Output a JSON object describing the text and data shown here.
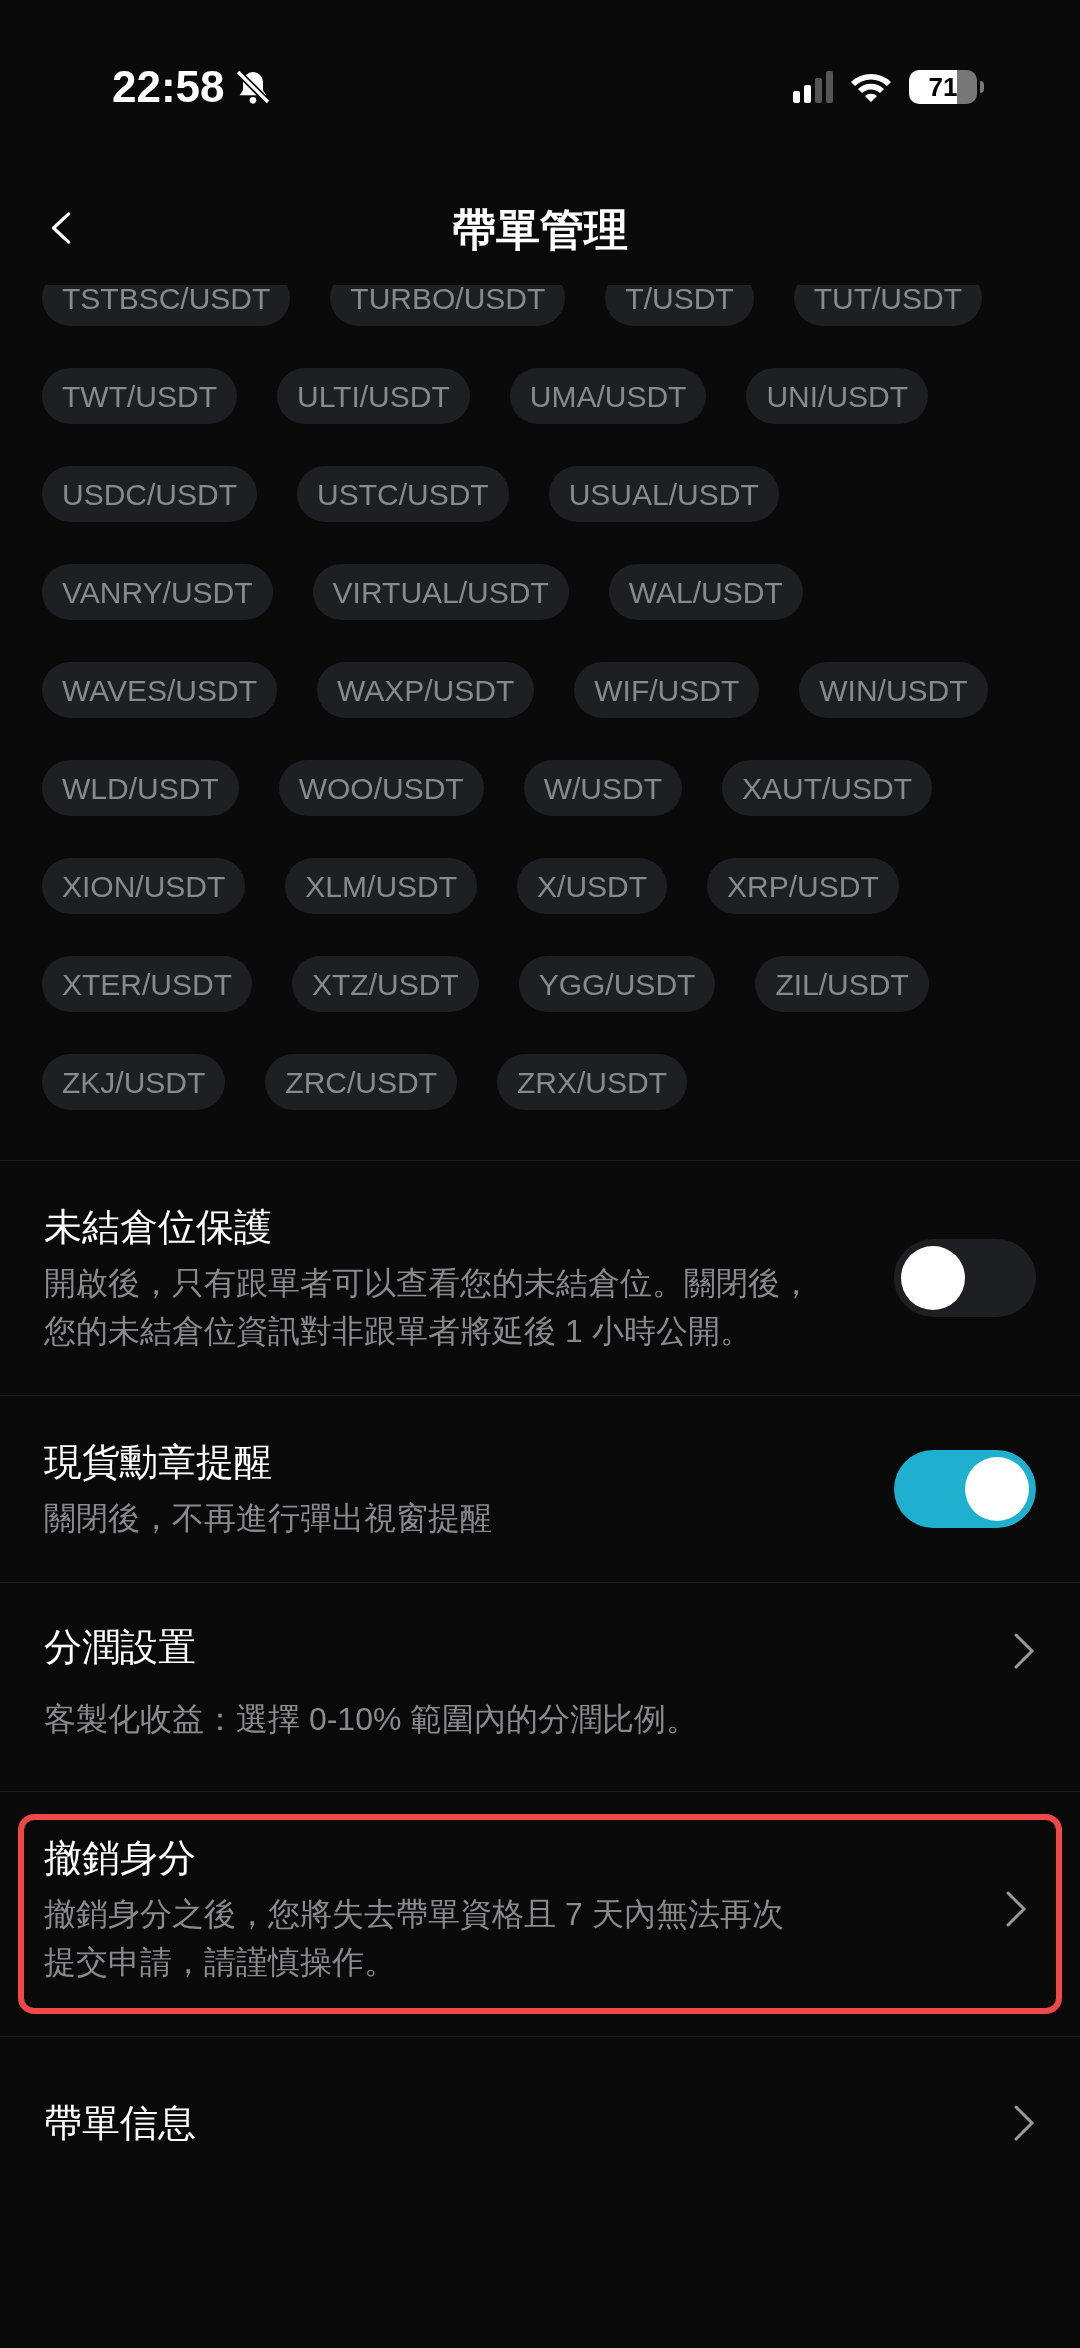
{
  "status_bar": {
    "time": "22:58",
    "silent": true,
    "battery": "71"
  },
  "header": {
    "title": "帶單管理"
  },
  "pair_rows": [
    [
      "TSTBSC/USDT",
      "TURBO/USDT",
      "T/USDT",
      "TUT/USDT"
    ],
    [
      "TWT/USDT",
      "ULTI/USDT",
      "UMA/USDT",
      "UNI/USDT"
    ],
    [
      "USDC/USDT",
      "USTC/USDT",
      "USUAL/USDT"
    ],
    [
      "VANRY/USDT",
      "VIRTUAL/USDT",
      "WAL/USDT"
    ],
    [
      "WAVES/USDT",
      "WAXP/USDT",
      "WIF/USDT",
      "WIN/USDT"
    ],
    [
      "WLD/USDT",
      "WOO/USDT",
      "W/USDT",
      "XAUT/USDT"
    ],
    [
      "XION/USDT",
      "XLM/USDT",
      "X/USDT",
      "XRP/USDT"
    ],
    [
      "XTER/USDT",
      "XTZ/USDT",
      "YGG/USDT",
      "ZIL/USDT"
    ],
    [
      "ZKJ/USDT",
      "ZRC/USDT",
      "ZRX/USDT"
    ]
  ],
  "settings": [
    {
      "kind": "toggle",
      "title": "未結倉位保護",
      "description": "開啟後，只有跟單者可以查看您的未結倉位。關閉後，您的未結倉位資訊對非跟單者將延後 1 小時公開。",
      "on": false,
      "highlighted": false
    },
    {
      "kind": "toggle",
      "title": "現貨勳章提醒",
      "description": "關閉後，不再進行彈出視窗提醒",
      "on": true,
      "highlighted": false
    },
    {
      "kind": "link",
      "title": "分潤設置",
      "description": "客製化收益：選擇 0-10% 範圍內的分潤比例。",
      "highlighted": false
    },
    {
      "kind": "link",
      "title": "撤銷身分",
      "description": "撤銷身分之後，您將失去帶單資格且 7 天內無法再次提交申請，請謹慎操作。",
      "highlighted": true
    },
    {
      "kind": "link",
      "title": "帶單信息",
      "highlighted": false
    }
  ]
}
